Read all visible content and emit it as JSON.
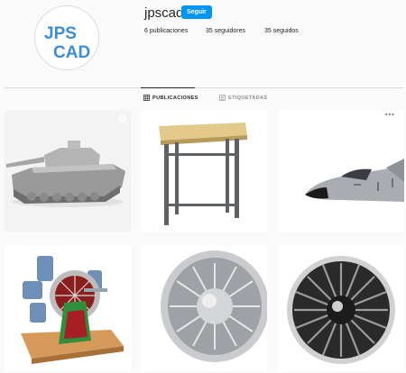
{
  "profile": {
    "username": "jpscad",
    "follow_label": "Seguir",
    "avatar_text_top": "JPS",
    "avatar_text_bottom": "CAD",
    "stats": {
      "posts": "6 publicaciones",
      "followers": "35 seguidores",
      "following": "35 seguidos"
    }
  },
  "tabs": [
    {
      "label": "PUBLICACIONES",
      "icon": "grid-icon",
      "active": true
    },
    {
      "label": "ETIQUETADAS",
      "icon": "tag-icon",
      "active": false
    }
  ],
  "posts": [
    {
      "subject": "tank",
      "icon": "multiple-images-icon"
    },
    {
      "subject": "stool"
    },
    {
      "subject": "jet"
    },
    {
      "subject": "radial-engine",
      "icon": "multiple-images-icon"
    },
    {
      "subject": "turbine-fan"
    },
    {
      "subject": "turbine-front",
      "icon": "multiple-images-icon"
    }
  ],
  "colors": {
    "accent": "#0095f6",
    "avatar_brand": "#3c8dd8",
    "text": "#262626",
    "muted": "#8e8e8e"
  }
}
